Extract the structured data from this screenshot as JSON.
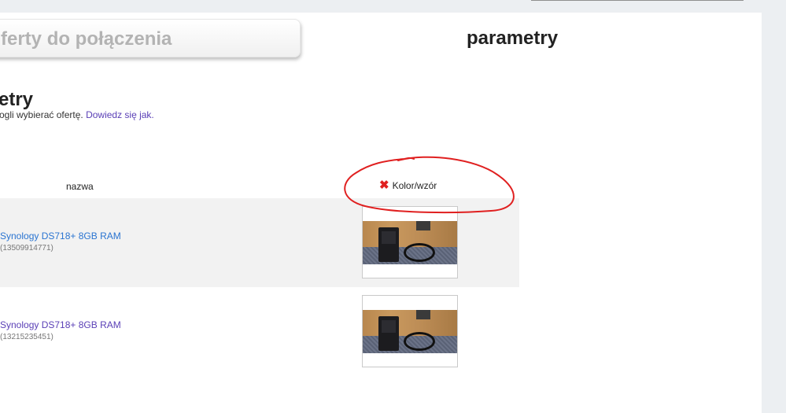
{
  "header": {
    "inactive_tab_label": "ferty do połączenia",
    "active_tab_label": "parametry"
  },
  "section": {
    "title": "etry",
    "description_prefix": "ogli wybierać ofertę.",
    "learn_more_link": "Dowiedz się jak."
  },
  "table": {
    "columns": {
      "name": "nazwa",
      "attribute": "Kolor/wzór",
      "attribute_status_icon": "x-icon"
    },
    "rows": [
      {
        "title": "Synology DS718+ 8GB RAM",
        "offer_id": "(13509914771)",
        "title_color": "#2a74d1",
        "thumbnail": "nas-photo"
      },
      {
        "title": "Synology DS718+ 8GB RAM",
        "offer_id": "(13215235451)",
        "title_color": "#5a3fb6",
        "thumbnail": "nas-photo"
      }
    ]
  },
  "annotation": {
    "color": "#e02020",
    "shape": "hand-drawn ellipse around Kolor/wzór"
  }
}
